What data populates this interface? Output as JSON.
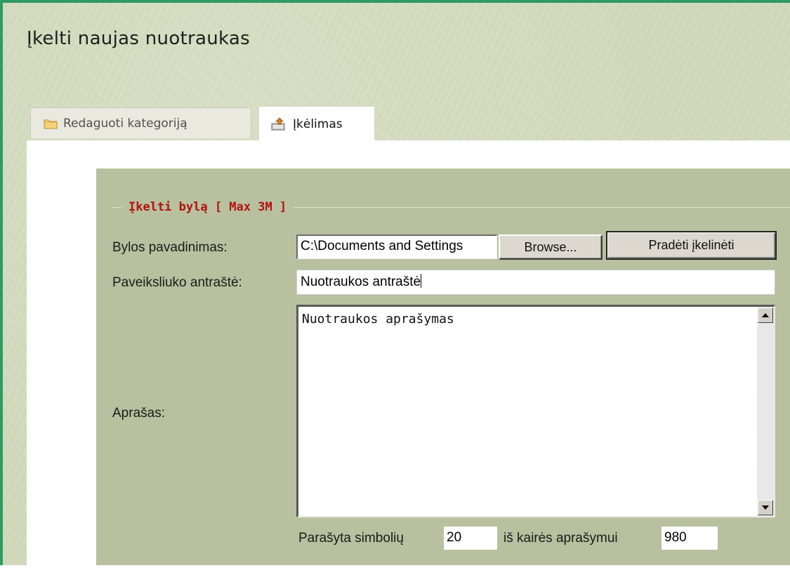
{
  "page": {
    "title": "Įkelti naujas nuotraukas"
  },
  "tabs": [
    {
      "label": "Redaguoti kategoriją",
      "icon": "folder-icon",
      "active": false
    },
    {
      "label": "Įkėlimas",
      "icon": "upload-icon",
      "active": true
    }
  ],
  "form": {
    "legend": "Įkelti bylą [ Max 3M ]",
    "file_label": "Bylos pavadinimas:",
    "file_value": "C:\\Documents and Settings",
    "browse_label": "Browse...",
    "upload_label": "Pradėti įkelinėti",
    "title_label": "Paveiksliuko antraštė:",
    "title_value": "Nuotraukos antraštė",
    "description_label": "Aprašas:",
    "description_value": "Nuotraukos aprašymas",
    "written_label": "Parašyta simbolių",
    "written_count": "20",
    "remaining_label": "iš kairės aprašymui",
    "remaining_count": "980"
  },
  "colors": {
    "frame_border": "#2f9a63",
    "page_background": "#cfd8b9",
    "form_panel": "#b8c09f",
    "legend_text": "#b2120d"
  }
}
